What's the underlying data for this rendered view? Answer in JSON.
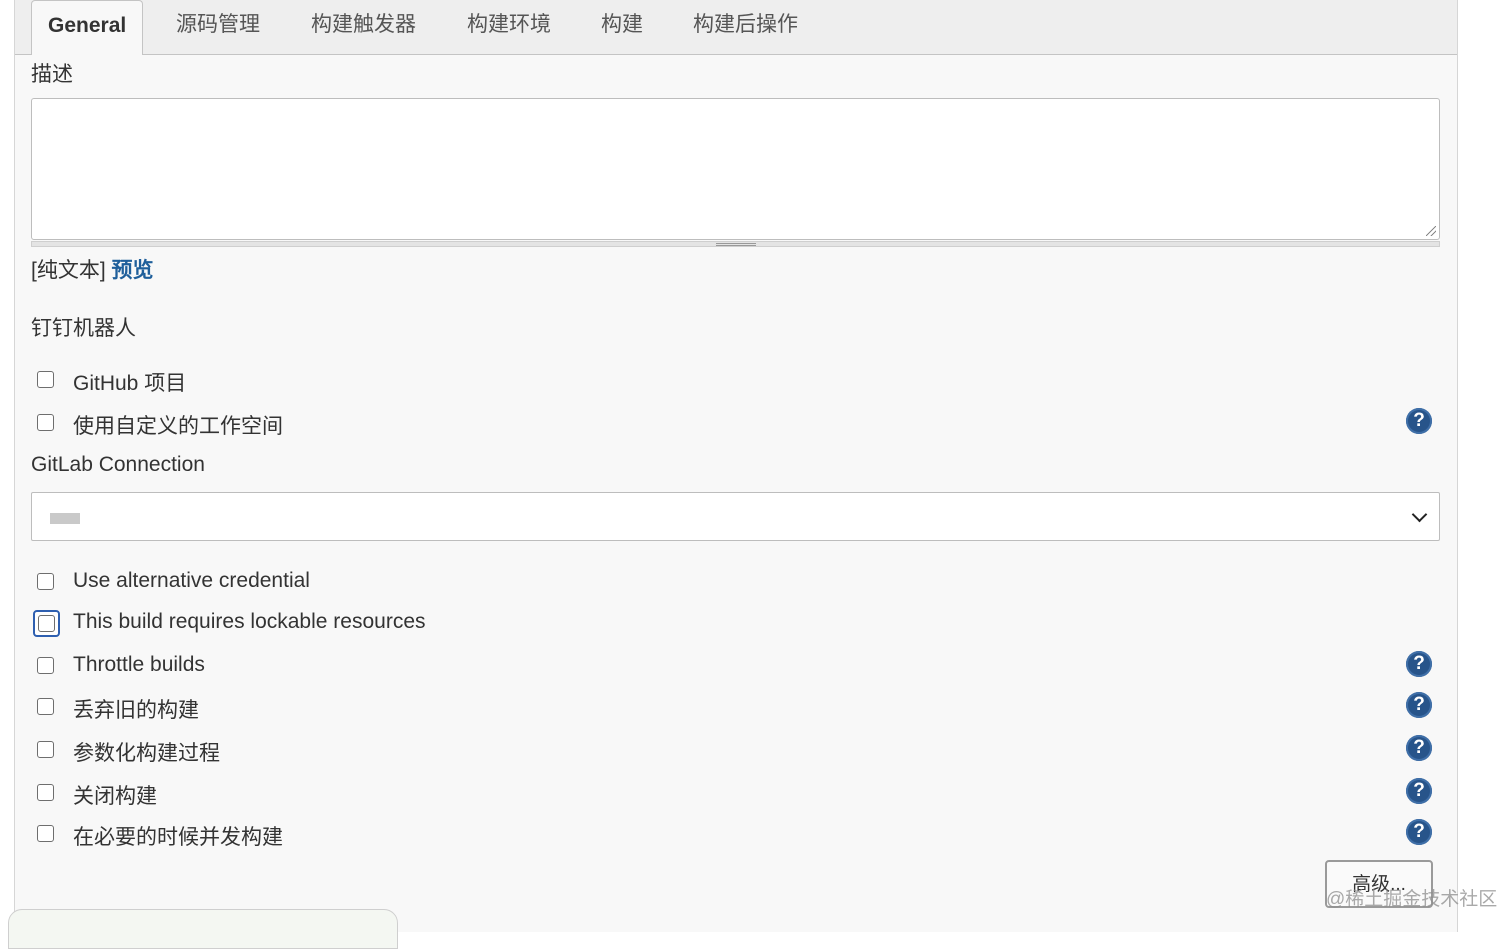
{
  "tabs": [
    "General",
    "源码管理",
    "构建触发器",
    "构建环境",
    "构建",
    "构建后操作"
  ],
  "description": {
    "label": "描述",
    "plain_text": "[纯文本]",
    "preview_link": "预览"
  },
  "dingtalk_label": "钉钉机器人",
  "options_top": [
    {
      "label": "GitHub 项目",
      "checked": false,
      "help": false
    },
    {
      "label": "使用自定义的工作空间",
      "checked": false,
      "help": true
    }
  ],
  "gitlab": {
    "label": "GitLab Connection",
    "selected_value": ""
  },
  "options_bottom": [
    {
      "label": "Use alternative credential",
      "checked": false,
      "help": false,
      "focused": false
    },
    {
      "label": "This build requires lockable resources",
      "checked": false,
      "help": false,
      "focused": true
    },
    {
      "label": "Throttle builds",
      "checked": false,
      "help": true,
      "focused": false
    },
    {
      "label": "丢弃旧的构建",
      "checked": false,
      "help": true,
      "focused": false
    },
    {
      "label": "参数化构建过程",
      "checked": false,
      "help": true,
      "focused": false
    },
    {
      "label": "关闭构建",
      "checked": false,
      "help": true,
      "focused": false
    },
    {
      "label": "在必要的时候并发构建",
      "checked": false,
      "help": true,
      "focused": false
    }
  ],
  "advanced_button": "高级...",
  "watermark": "@稀土掘金技术社区",
  "help_glyph": "?",
  "colors": {
    "accent": "#27548a",
    "link": "#1f5f9b",
    "focus": "#2e5fb0"
  }
}
